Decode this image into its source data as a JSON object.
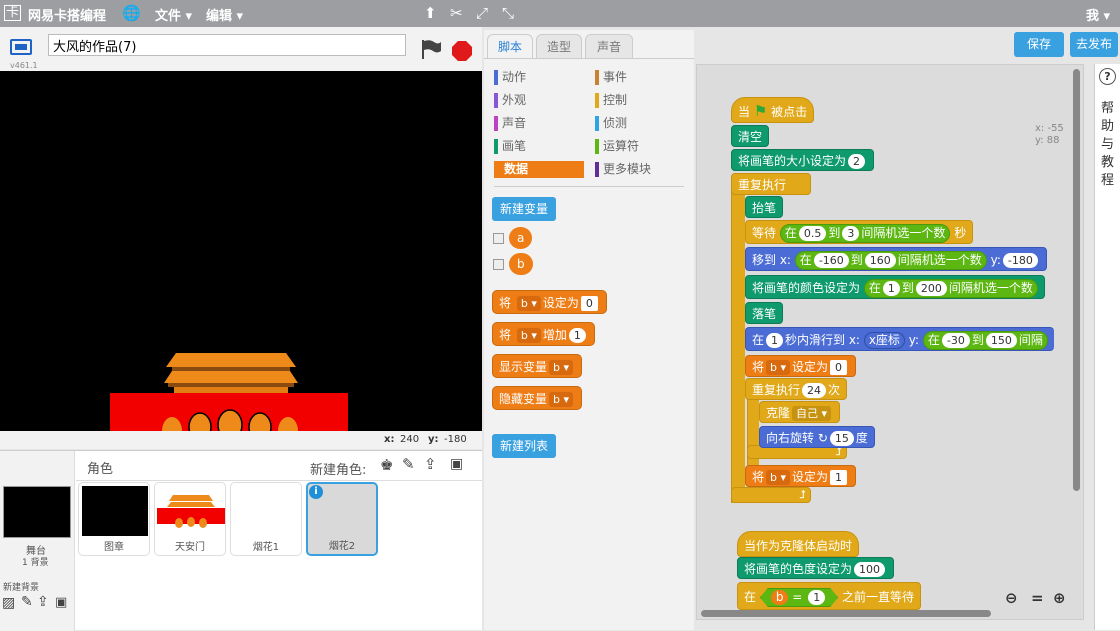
{
  "topbar": {
    "logo_text": "网易卡搭编程",
    "menu_file": "文件",
    "menu_edit": "编辑",
    "user": "我"
  },
  "stage_header": {
    "title": "大风的作品(7)",
    "version": "v461.1"
  },
  "coords": {
    "x_label": "x:",
    "x_value": "240",
    "y_label": "y:",
    "y_value": "-180"
  },
  "sprites": {
    "header": "角色",
    "new_sprite_label": "新建角色:",
    "stage_label": "舞台",
    "stage_backdrops": "1 背景",
    "new_backdrop_label": "新建背景",
    "items": [
      {
        "name": "图章"
      },
      {
        "name": "天安门"
      },
      {
        "name": "烟花1"
      },
      {
        "name": "烟花2"
      }
    ]
  },
  "tabs": [
    "脚本",
    "造型",
    "声音"
  ],
  "categories_left": [
    "动作",
    "外观",
    "声音",
    "画笔",
    "数据"
  ],
  "categories_right": [
    "事件",
    "控制",
    "侦测",
    "运算符",
    "更多模块"
  ],
  "category_colors": [
    "#4a6cd4",
    "#8a55d7",
    "#bb42c3",
    "#0e9a6c",
    "#ee7d16",
    "#c88330",
    "#e1a91a",
    "#2ca5e2",
    "#5cb712",
    "#632d99"
  ],
  "palette": {
    "new_variable": "新建变量",
    "vars": [
      "a",
      "b"
    ],
    "set_block": {
      "prefix": "将",
      "var": "b",
      "mid": "设定为",
      "value": "0"
    },
    "change_block": {
      "prefix": "将",
      "var": "b",
      "mid": "增加",
      "value": "1"
    },
    "show_block": {
      "label": "显示变量",
      "var": "b"
    },
    "hide_block": {
      "label": "隐藏变量",
      "var": "b"
    },
    "new_list": "新建列表"
  },
  "buttons": {
    "save": "保存",
    "share": "去发布"
  },
  "script": {
    "mouse_x": "x: -55",
    "mouse_y": "y: 88",
    "s1_when": "当",
    "s1_clicked": "被点击",
    "clear": "清空",
    "pen_size": "将画笔的大小设定为",
    "pen_size_val": "2",
    "forever": "重复执行",
    "pen_up": "抬笔",
    "wait": "等待",
    "wait_in": "在",
    "wait_from": "0.5",
    "wait_to": "到",
    "wait_max": "3",
    "wait_pick": "间隔机选一个数",
    "wait_sec": "秒",
    "goto": "移到 x:",
    "goto_in": "在",
    "goto_from": "-160",
    "goto_to": "到",
    "goto_max": "160",
    "goto_pick": "间隔机选一个数",
    "goto_y": "y:",
    "goto_y_val": "-180",
    "pen_color": "将画笔的颜色设定为",
    "pc_in": "在",
    "pc_from": "1",
    "pc_to": "到",
    "pc_max": "200",
    "pc_pick": "间隔机选一个数",
    "pen_down": "落笔",
    "glide_in": "在",
    "glide_sec": "1",
    "glide_label": "秒内滑行到 x:",
    "glide_xpos": "x座标",
    "glide_y": "y:",
    "glide_in2": "在",
    "glide_from": "-30",
    "glide_to": "到",
    "glide_max": "150",
    "glide_pick": "间隔",
    "set_b": "将",
    "set_b_var": "b",
    "set_b_to": "设定为",
    "set_b_val": "0",
    "repeat": "重复执行",
    "repeat_n": "24",
    "repeat_times": "次",
    "clone": "克隆",
    "clone_target": "自己",
    "turn": "向右旋转",
    "turn_deg": "15",
    "turn_unit": "度",
    "set_b2": "将",
    "set_b2_var": "b",
    "set_b2_to": "设定为",
    "set_b2_val": "1",
    "s2_hat": "当作为克隆体启动时",
    "s2_color": "将画笔的色度设定为",
    "s2_color_val": "100",
    "s2_wait": "在",
    "s2_var": "b",
    "s2_eq": "=",
    "s2_val": "1",
    "s2_until": "之前一直等待"
  },
  "help_text": "帮助与教程"
}
